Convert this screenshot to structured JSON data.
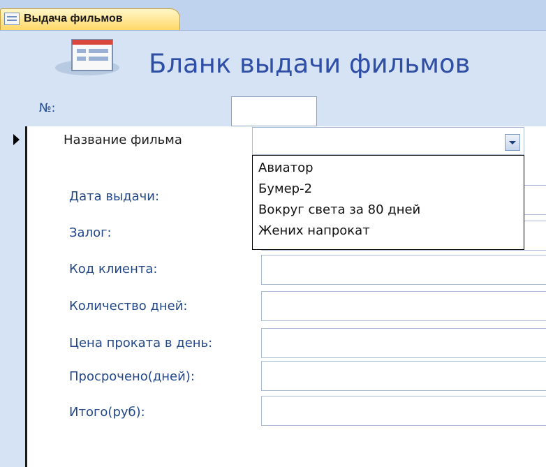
{
  "tab": {
    "label": "Выдача фильмов"
  },
  "form": {
    "title": "Бланк выдачи фильмов",
    "number_label": "№:",
    "number_value": ""
  },
  "film": {
    "label": "Название фильма",
    "value": ""
  },
  "dropdown": {
    "options": [
      "Авиатор",
      "Бумер-2",
      "Вокруг света за 80 дней",
      "Жених напрокат"
    ]
  },
  "fields": [
    {
      "label": "Дата выдачи:",
      "value": ""
    },
    {
      "label": "Залог:",
      "value": ""
    },
    {
      "label": "Код клиента:",
      "value": ""
    },
    {
      "label": "Количество дней:",
      "value": ""
    },
    {
      "label": "Цена проката в день:",
      "value": ""
    },
    {
      "label": "Просрочено(дней):",
      "value": ""
    },
    {
      "label": "Итого(руб):",
      "value": ""
    }
  ],
  "colors": {
    "header_bg": "#d5e3f5",
    "tab_bg": "#ffd968",
    "title_color": "#2f4ea5",
    "label_color": "#22488a"
  }
}
